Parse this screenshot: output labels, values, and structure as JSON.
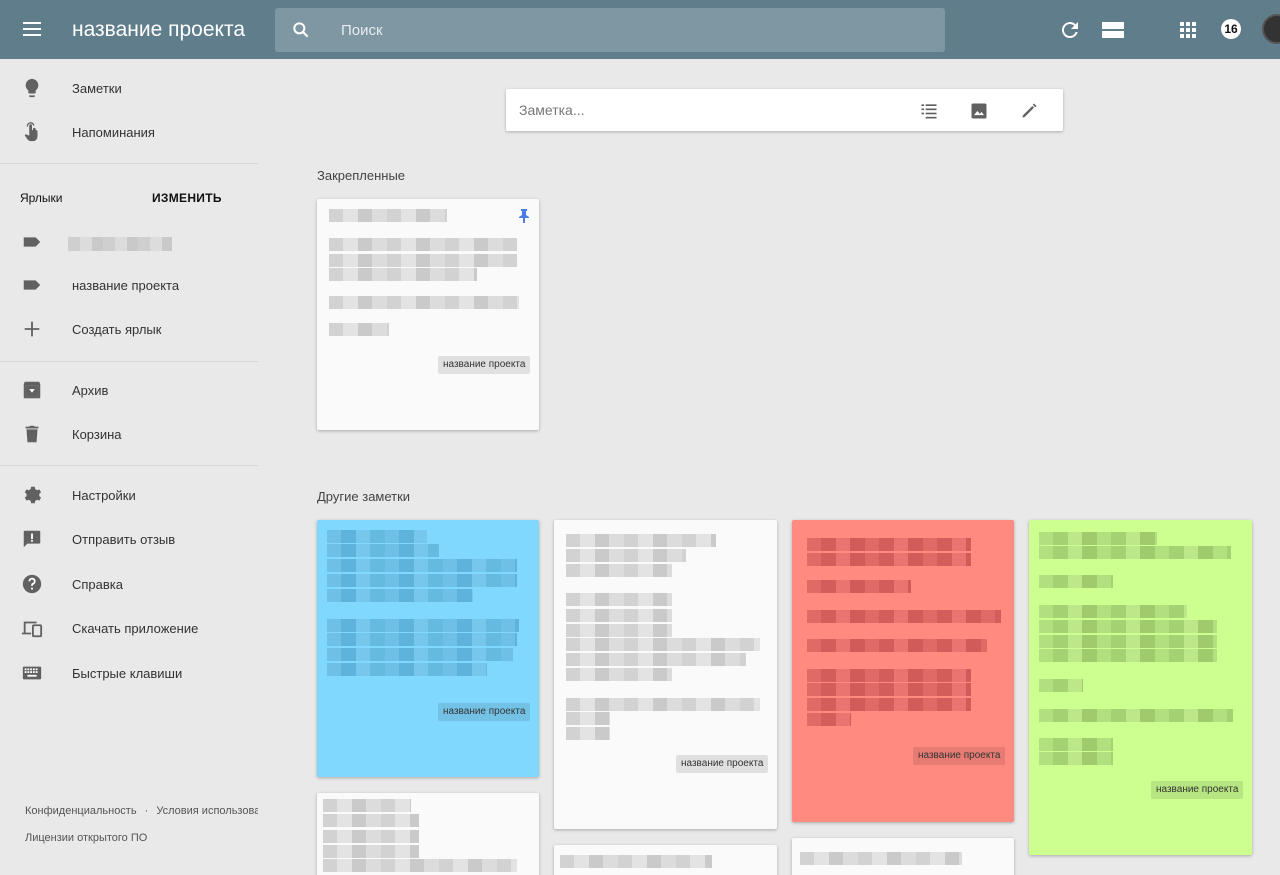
{
  "header": {
    "title": "название проекта",
    "search_placeholder": "Поиск",
    "notif_count": "16",
    "colors": {
      "bar": "#607d8b",
      "search": "#7f97a2"
    }
  },
  "sidebar": {
    "notes": "Заметки",
    "reminders": "Напоминания",
    "labels_heading": "Ярлыки",
    "labels_edit": "ИЗМЕНИТЬ",
    "label_project": "название проекта",
    "create_label": "Создать ярлык",
    "archive": "Архив",
    "trash": "Корзина",
    "settings": "Настройки",
    "feedback": "Отправить отзыв",
    "help": "Справка",
    "download": "Скачать приложение",
    "shortcuts": "Быстрые клавиши",
    "privacy": "Конфиденциальность",
    "dot": "·",
    "terms": "Условия использования",
    "licenses": "Лицензии открытого ПО"
  },
  "main": {
    "composer_placeholder": "Заметка...",
    "pinned_title": "Закрепленные",
    "others_title": "Другие заметки",
    "note_label": "название проекта",
    "note_colors": {
      "blue": "#80d8ff",
      "red": "#ff8a80",
      "green": "#ccff90",
      "white": "#fafafa"
    }
  }
}
